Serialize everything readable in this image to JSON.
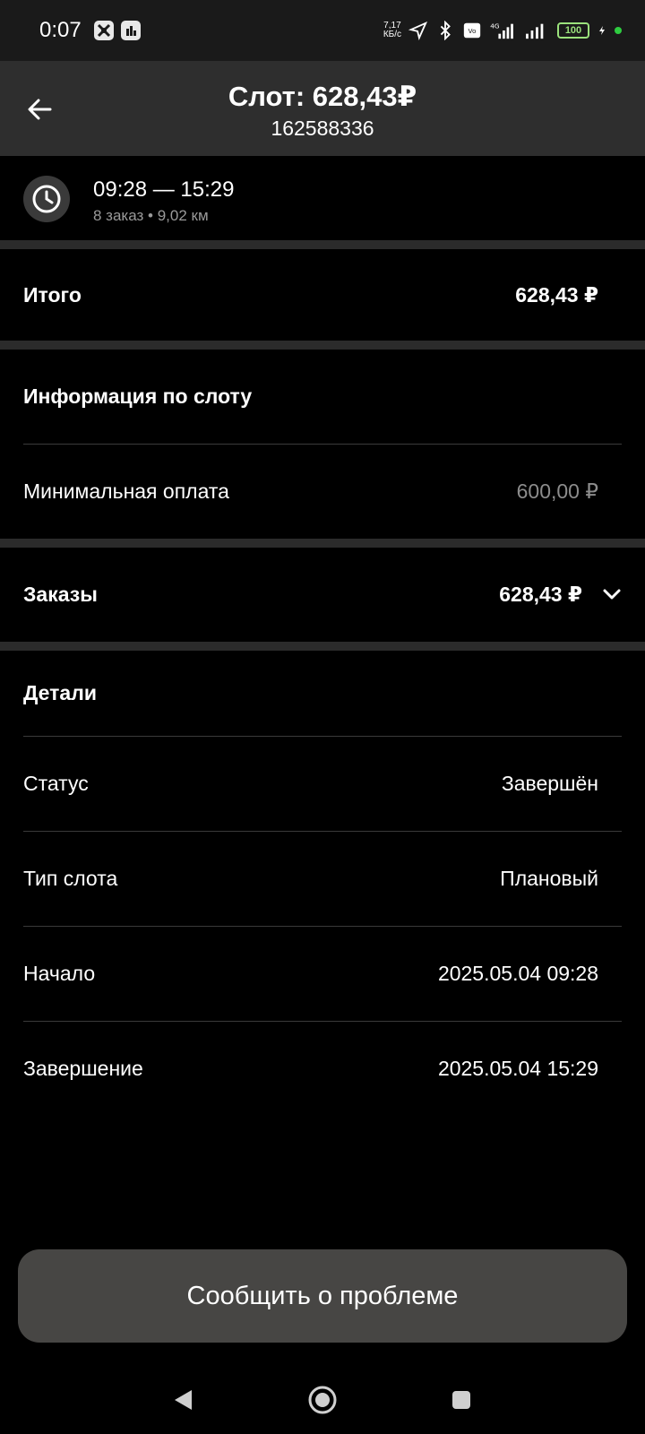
{
  "status_bar": {
    "time": "0:07",
    "speed_top": "7,17",
    "speed_bottom": "КБ/с",
    "battery": "100"
  },
  "header": {
    "title": "Слот: 628,43₽",
    "subtitle": "162588336"
  },
  "slot_time": {
    "range": "09:28 — 15:29",
    "meta": "8 заказ • 9,02 км"
  },
  "total": {
    "label": "Итого",
    "value": "628,43 ₽"
  },
  "slot_info": {
    "heading": "Информация по слоту",
    "min_payment_label": "Минимальная оплата",
    "min_payment_value": "600,00 ₽"
  },
  "orders": {
    "label": "Заказы",
    "value": "628,43 ₽"
  },
  "details": {
    "heading": "Детали",
    "rows": [
      {
        "label": "Статус",
        "value": "Завершён"
      },
      {
        "label": "Тип слота",
        "value": "Плановый"
      },
      {
        "label": "Начало",
        "value": "2025.05.04 09:28"
      },
      {
        "label": "Завершение",
        "value": "2025.05.04 15:29"
      }
    ]
  },
  "report_button": "Сообщить о проблеме",
  "colors": {
    "background": "#000000",
    "app_bar": "#2e2e2e",
    "divider": "#2b2b2b",
    "button": "#474644",
    "muted_text": "#8c8c8c"
  }
}
